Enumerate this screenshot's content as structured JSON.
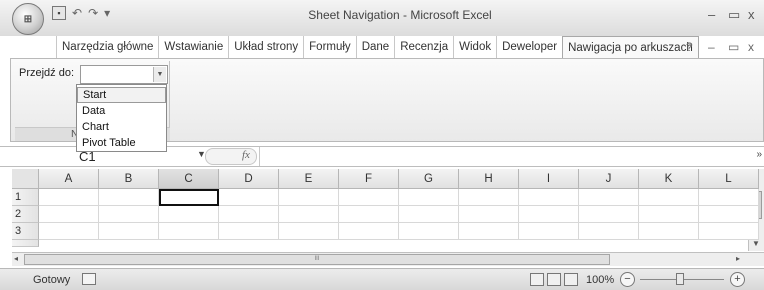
{
  "title_bar": {
    "window_title": "Sheet Navigation - Microsoft Excel",
    "office_button": "Office",
    "minimize": "–",
    "restore": "▭",
    "close": "x"
  },
  "quick_access": {
    "undo": "↶",
    "redo": "↷",
    "customize": "▾"
  },
  "ribbon": {
    "tabs": [
      {
        "label": "Narzędzia główne"
      },
      {
        "label": "Wstawianie"
      },
      {
        "label": "Układ strony"
      },
      {
        "label": "Formuły"
      },
      {
        "label": "Dane"
      },
      {
        "label": "Recenzja"
      },
      {
        "label": "Widok"
      },
      {
        "label": "Deweloper"
      },
      {
        "label": "Nawigacja po arkuszach"
      }
    ],
    "active_tab_index": 8,
    "tab_controls": {
      "help": "?",
      "minimize": "–",
      "restore": "▭",
      "close": "x"
    },
    "group": {
      "goto_label": "Przejdź do:",
      "caption": "N",
      "dropdown_options": [
        "Start",
        "Data",
        "Chart",
        "Pivot Table"
      ],
      "selected_option_index": 0
    }
  },
  "formula_bar": {
    "name_box": "C1",
    "fx": "fx",
    "formula": "",
    "expand": "»"
  },
  "sheet": {
    "columns": [
      "A",
      "B",
      "C",
      "D",
      "E",
      "F",
      "G",
      "H",
      "I",
      "J",
      "K",
      "L"
    ],
    "rows": [
      "1",
      "2",
      "3"
    ],
    "active_cell": "C1",
    "active_column": "C"
  },
  "hscroll": {
    "grip": "III",
    "left": "◂",
    "right": "▸"
  },
  "status_bar": {
    "text": "Gotowy",
    "zoom": "100%",
    "zoom_minus": "−",
    "zoom_plus": "+"
  }
}
